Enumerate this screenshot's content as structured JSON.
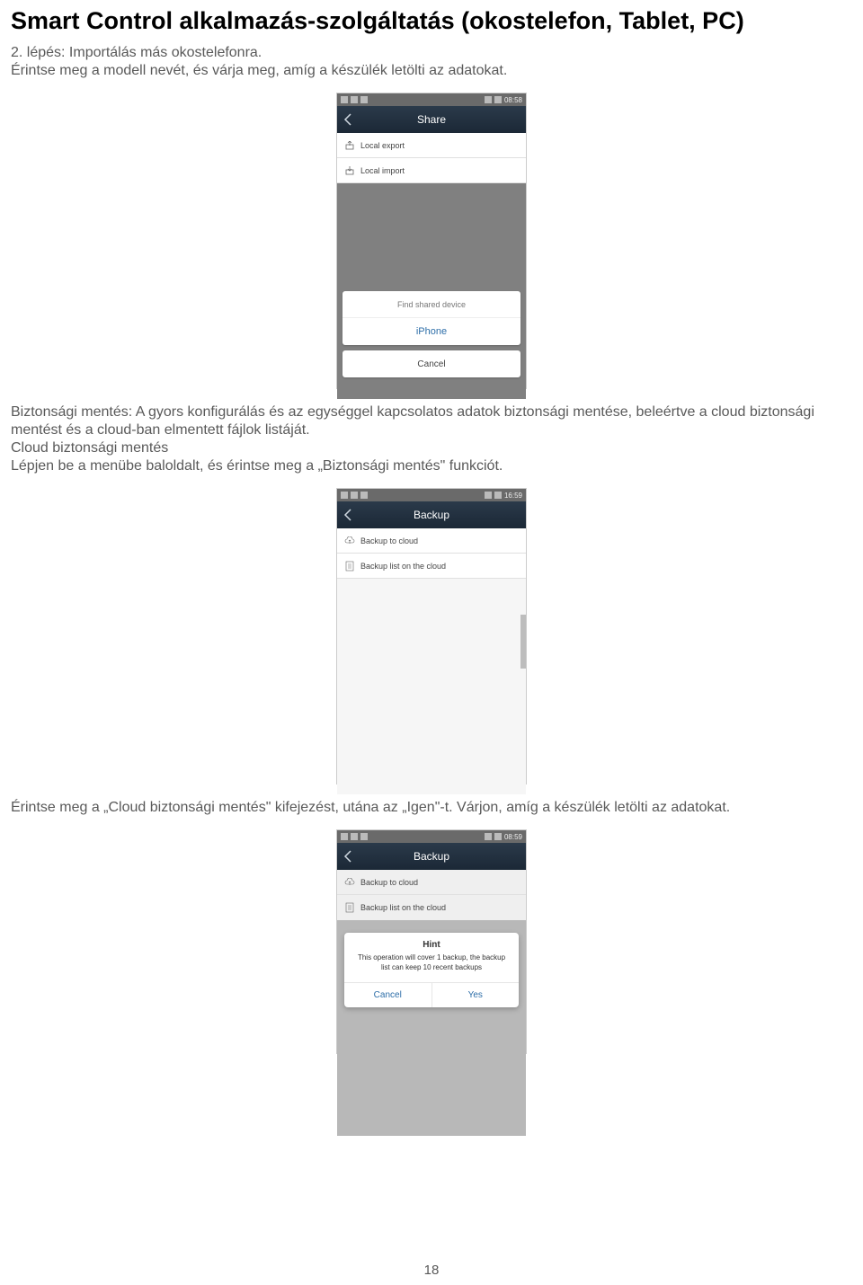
{
  "page": {
    "title": "Smart Control alkalmazás-szolgáltatás (okostelefon, Tablet, PC)",
    "intro": "2. lépés: Importálás más okostelefonra.\nÉrintse meg a modell nevét, és várja meg, amíg a készülék letölti az adatokat.",
    "para2": "Biztonsági mentés: A gyors konfigurálás és az egységgel kapcsolatos adatok biztonsági mentése, beleértve a cloud biztonsági mentést és a cloud-ban elmentett fájlok listáját.\nCloud biztonsági mentés\nLépjen be a menübe baloldalt, és érintse meg a „Biztonsági mentés\" funkciót.",
    "para3": "Érintse meg a „Cloud biztonsági mentés\" kifejezést, utána az „Igen\"-t. Várjon, amíg a készülék letölti az adatokat.",
    "page_number": "18"
  },
  "phone1": {
    "time": "08:58",
    "title": "Share",
    "rows": {
      "local_export": "Local export",
      "local_import": "Local import"
    },
    "sheet": {
      "header": "Find shared device",
      "device": "iPhone",
      "cancel": "Cancel"
    }
  },
  "phone2": {
    "time": "16:59",
    "title": "Backup",
    "rows": {
      "backup_to_cloud": "Backup to cloud",
      "backup_list": "Backup list on the cloud"
    }
  },
  "phone3": {
    "time": "08:59",
    "title": "Backup",
    "rows": {
      "backup_to_cloud": "Backup to cloud",
      "backup_list": "Backup list on the cloud"
    },
    "hint": {
      "title": "Hint",
      "message": "This operation will cover 1 backup, the backup list can keep 10 recent backups",
      "cancel": "Cancel",
      "yes": "Yes"
    }
  }
}
